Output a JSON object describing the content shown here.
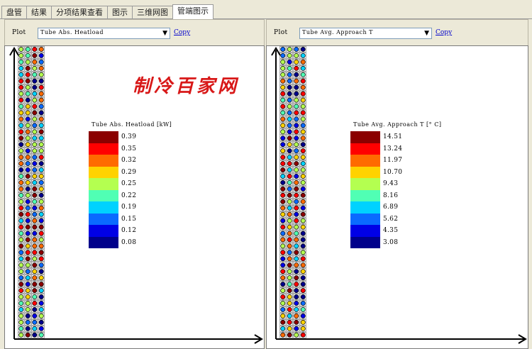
{
  "tabs": [
    {
      "label": "盘管"
    },
    {
      "label": "结果"
    },
    {
      "label": "分项结果查看"
    },
    {
      "label": "图示"
    },
    {
      "label": "三维网图"
    },
    {
      "label": "管端图示"
    }
  ],
  "active_tab_index": 5,
  "watermark": "制冷百家网",
  "panels": [
    {
      "plot_label": "Plot",
      "selected": "Tube Abs. Heatload",
      "copy_label": "Copy",
      "legend_title": "Tube Abs. Heatload [kW]",
      "legend_values": [
        "0.39",
        "0.35",
        "0.32",
        "0.29",
        "0.25",
        "0.22",
        "0.19",
        "0.15",
        "0.12",
        "0.08"
      ]
    },
    {
      "plot_label": "Plot",
      "selected": "Tube Avg. Approach T",
      "copy_label": "Copy",
      "legend_title": "Tube Avg. Approach T [° C]",
      "legend_values": [
        "14.51",
        "13.24",
        "11.97",
        "10.70",
        "9.43",
        "8.16",
        "6.89",
        "5.62",
        "4.35",
        "3.08"
      ]
    }
  ],
  "colors": {
    "scale": [
      "#8b0000",
      "#ff0000",
      "#ff6a00",
      "#ffd200",
      "#b4ff50",
      "#50ffb4",
      "#00d2ff",
      "#0a6aff",
      "#0000e6",
      "#00008b"
    ],
    "watermark": "#d81818",
    "link": "#0000cc"
  }
}
